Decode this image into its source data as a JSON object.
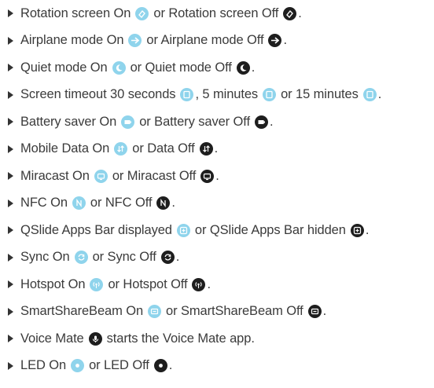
{
  "items": [
    {
      "parts": [
        {
          "t": "Rotation screen On"
        },
        {
          "icon": "rotation-on-icon",
          "state": "on",
          "glyph": "rot"
        },
        {
          "t": "or Rotation screen Off"
        },
        {
          "icon": "rotation-off-icon",
          "state": "off",
          "glyph": "rot"
        },
        {
          "t": "."
        }
      ]
    },
    {
      "parts": [
        {
          "t": "Airplane mode On"
        },
        {
          "icon": "airplane-on-icon",
          "state": "on",
          "glyph": "plane"
        },
        {
          "t": "or Airplane mode Off"
        },
        {
          "icon": "airplane-off-icon",
          "state": "off",
          "glyph": "plane"
        },
        {
          "t": "."
        }
      ]
    },
    {
      "parts": [
        {
          "t": "Quiet mode On"
        },
        {
          "icon": "quiet-mode-on-icon",
          "state": "on",
          "glyph": "moon"
        },
        {
          "t": "or Quiet mode Off"
        },
        {
          "icon": "quiet-mode-off-icon",
          "state": "off",
          "glyph": "moon"
        },
        {
          "t": "."
        }
      ]
    },
    {
      "parts": [
        {
          "t": "Screen timeout 30 seconds"
        },
        {
          "icon": "timeout-30-seconds-icon",
          "state": "on",
          "glyph": "screen"
        },
        {
          "t": ", 5 minutes"
        },
        {
          "icon": "timeout-5-minutes-icon",
          "state": "on",
          "glyph": "screen"
        },
        {
          "t": "or 15 minutes"
        },
        {
          "icon": "timeout-15-minutes-icon",
          "state": "on",
          "glyph": "screen"
        },
        {
          "t": "."
        }
      ]
    },
    {
      "parts": [
        {
          "t": "Battery saver On"
        },
        {
          "icon": "battery-saver-on-icon",
          "state": "on",
          "glyph": "battery"
        },
        {
          "t": "or Battery saver Off"
        },
        {
          "icon": "battery-saver-off-icon",
          "state": "off",
          "glyph": "battery"
        },
        {
          "t": "."
        }
      ]
    },
    {
      "parts": [
        {
          "t": "Mobile Data On"
        },
        {
          "icon": "mobile-data-on-icon",
          "state": "on",
          "glyph": "data"
        },
        {
          "t": "or Data Off"
        },
        {
          "icon": "mobile-data-off-icon",
          "state": "off",
          "glyph": "data"
        },
        {
          "t": "."
        }
      ]
    },
    {
      "parts": [
        {
          "t": "Miracast On"
        },
        {
          "icon": "miracast-on-icon",
          "state": "on",
          "glyph": "cast"
        },
        {
          "t": "or Miracast Off"
        },
        {
          "icon": "miracast-off-icon",
          "state": "off",
          "glyph": "cast"
        },
        {
          "t": "."
        }
      ]
    },
    {
      "parts": [
        {
          "t": "NFC On"
        },
        {
          "icon": "nfc-on-icon",
          "state": "on",
          "glyph": "nfc"
        },
        {
          "t": "or NFC Off"
        },
        {
          "icon": "nfc-off-icon",
          "state": "off",
          "glyph": "nfc"
        },
        {
          "t": "."
        }
      ]
    },
    {
      "parts": [
        {
          "t": "QSlide Apps Bar displayed"
        },
        {
          "icon": "qslide-displayed-icon",
          "state": "on",
          "glyph": "qslide"
        },
        {
          "t": "or QSlide Apps Bar hidden"
        },
        {
          "icon": "qslide-hidden-icon",
          "state": "off",
          "glyph": "qslide"
        },
        {
          "t": "."
        }
      ]
    },
    {
      "parts": [
        {
          "t": "Sync On"
        },
        {
          "icon": "sync-on-icon",
          "state": "on",
          "glyph": "sync"
        },
        {
          "t": "or Sync Off"
        },
        {
          "icon": "sync-off-icon",
          "state": "off",
          "glyph": "sync"
        },
        {
          "t": "."
        }
      ]
    },
    {
      "parts": [
        {
          "t": "Hotspot On"
        },
        {
          "icon": "hotspot-on-icon",
          "state": "on",
          "glyph": "hotspot"
        },
        {
          "t": "or Hotspot Off"
        },
        {
          "icon": "hotspot-off-icon",
          "state": "off",
          "glyph": "hotspot"
        },
        {
          "t": "."
        }
      ]
    },
    {
      "parts": [
        {
          "t": "SmartShareBeam On"
        },
        {
          "icon": "smartsharebeam-on-icon",
          "state": "on",
          "glyph": "beam"
        },
        {
          "t": "or SmartShareBeam Off"
        },
        {
          "icon": "smartsharebeam-off-icon",
          "state": "off",
          "glyph": "beam"
        },
        {
          "t": "."
        }
      ]
    },
    {
      "parts": [
        {
          "t": "Voice Mate"
        },
        {
          "icon": "voice-mate-icon",
          "state": "off",
          "glyph": "mic"
        },
        {
          "t": "starts the Voice Mate app."
        }
      ]
    },
    {
      "parts": [
        {
          "t": "LED On"
        },
        {
          "icon": "led-on-icon",
          "state": "on",
          "glyph": "led"
        },
        {
          "t": "or LED Off"
        },
        {
          "icon": "led-off-icon",
          "state": "off",
          "glyph": "led"
        },
        {
          "t": "."
        }
      ]
    }
  ],
  "colors": {
    "text": "#3b3b3b",
    "icon_on": "#8fd4ec",
    "icon_off": "#1e1e1e"
  }
}
